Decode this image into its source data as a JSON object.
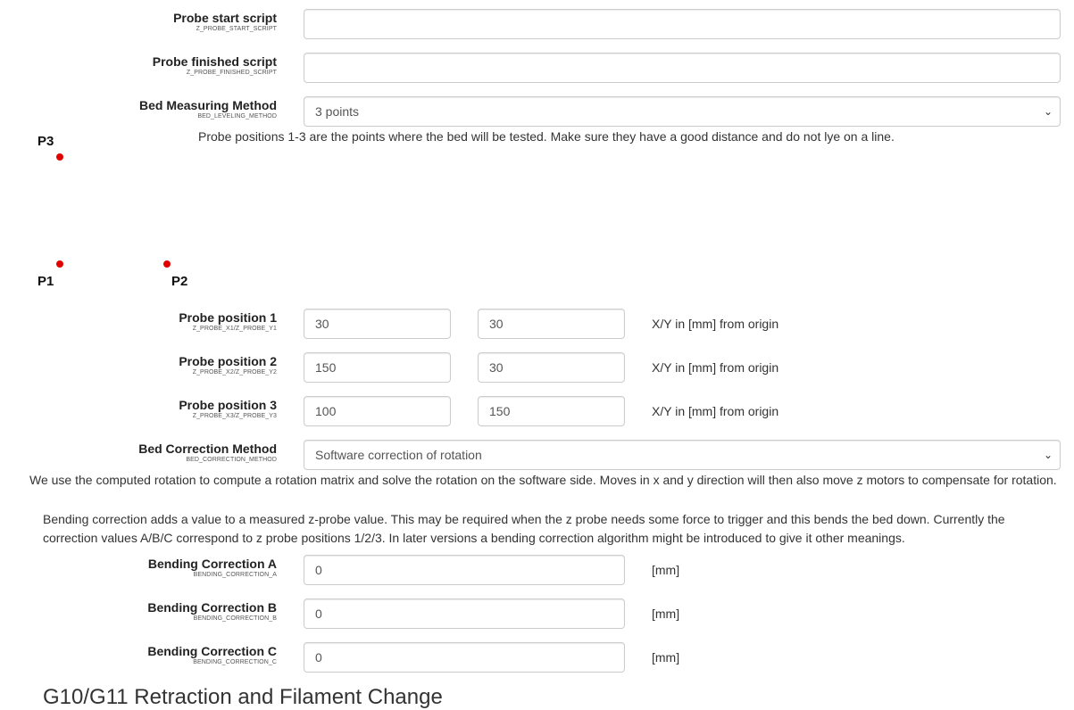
{
  "probe_start_script": {
    "label": "Probe start script",
    "code": "Z_PROBE_START_SCRIPT",
    "value": ""
  },
  "probe_finished_script": {
    "label": "Probe finished script",
    "code": "Z_PROBE_FINISHED_SCRIPT",
    "value": ""
  },
  "bed_measuring_method": {
    "label": "Bed Measuring Method",
    "code": "BED_LEVELING_METHOD",
    "selected": "3 points",
    "note": "Probe positions 1-3 are the points where the bed will be tested. Make sure they have a good distance and do not lye on a line."
  },
  "diagram": {
    "p1": "P1",
    "p2": "P2",
    "p3": "P3",
    "dot_color": "#e00000"
  },
  "probe_positions": [
    {
      "label": "Probe position 1",
      "code": "Z_PROBE_X1/Z_PROBE_Y1",
      "x": "30",
      "y": "30",
      "unit": "X/Y in [mm] from origin"
    },
    {
      "label": "Probe position 2",
      "code": "Z_PROBE_X2/Z_PROBE_Y2",
      "x": "150",
      "y": "30",
      "unit": "X/Y in [mm] from origin"
    },
    {
      "label": "Probe position 3",
      "code": "Z_PROBE_X3/Z_PROBE_Y3",
      "x": "100",
      "y": "150",
      "unit": "X/Y in [mm] from origin"
    }
  ],
  "bed_correction_method": {
    "label": "Bed Correction Method",
    "code": "BED_CORRECTION_METHOD",
    "selected": "Software correction of rotation",
    "note": "We use the computed rotation to compute a rotation matrix and solve the rotation on the software side. Moves in x and y direction will then also move z motors to compensate for rotation."
  },
  "bending_description": "Bending correction adds a value to a measured z-probe value. This may be required when the z probe needs some force to trigger and this bends the bed down. Currently the correction values A/B/C correspond to z probe positions 1/2/3. In later versions a bending correction algorithm might be introduced to give it other meanings.",
  "bending": [
    {
      "label": "Bending Correction A",
      "code": "BENDING_CORRECTION_A",
      "value": "0",
      "unit": "[mm]"
    },
    {
      "label": "Bending Correction B",
      "code": "BENDING_CORRECTION_B",
      "value": "0",
      "unit": "[mm]"
    },
    {
      "label": "Bending Correction C",
      "code": "BENDING_CORRECTION_C",
      "value": "0",
      "unit": "[mm]"
    }
  ],
  "next_section_heading": "G10/G11 Retraction and Filament Change",
  "icons": {
    "select_arrow": "chevron-down-icon"
  }
}
